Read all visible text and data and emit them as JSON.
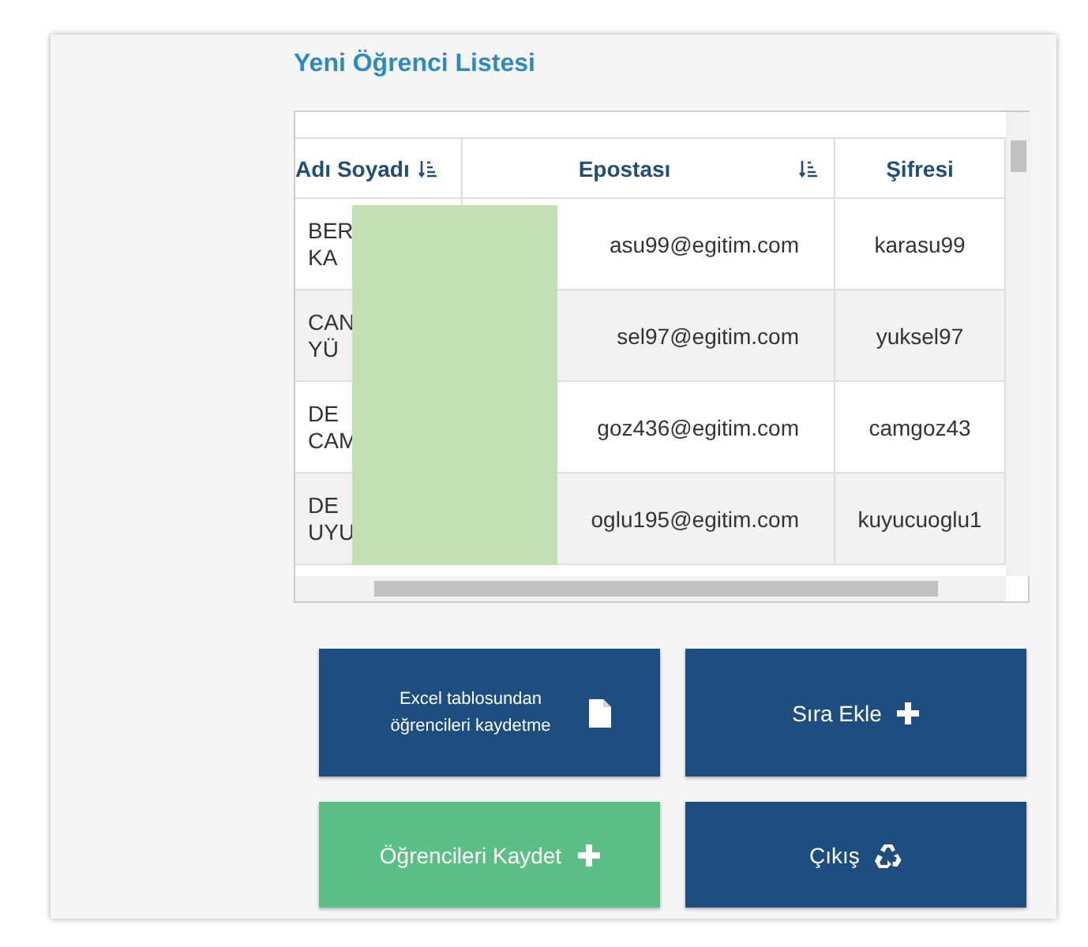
{
  "title": "Yeni Öğrenci Listesi",
  "table": {
    "columns": [
      "Adı Soyadı",
      "Epostası",
      "Şifresi"
    ],
    "rows": [
      {
        "name": [
          "BER",
          "KA"
        ],
        "email": "asu99@egitim.com",
        "password": "karasu99"
      },
      {
        "name": [
          "CAN",
          "YÜ"
        ],
        "email": "sel97@egitim.com",
        "password": "yuksel97"
      },
      {
        "name": [
          "DE",
          "CAM"
        ],
        "email": "goz436@egitim.com",
        "password": "camgoz43"
      },
      {
        "name": [
          "DE",
          "UYU"
        ],
        "email": "oglu195@egitim.com",
        "password": "kuyucuoglu1"
      }
    ]
  },
  "buttons": [
    {
      "kind": "import",
      "label": "Excel tablosundan öğrencileri kaydetme"
    },
    {
      "kind": "add",
      "label": "Sıra Ekle"
    },
    {
      "kind": "save",
      "label": "Öğrencileri Kaydet"
    },
    {
      "kind": "exit",
      "label": "Çıkış"
    }
  ]
}
